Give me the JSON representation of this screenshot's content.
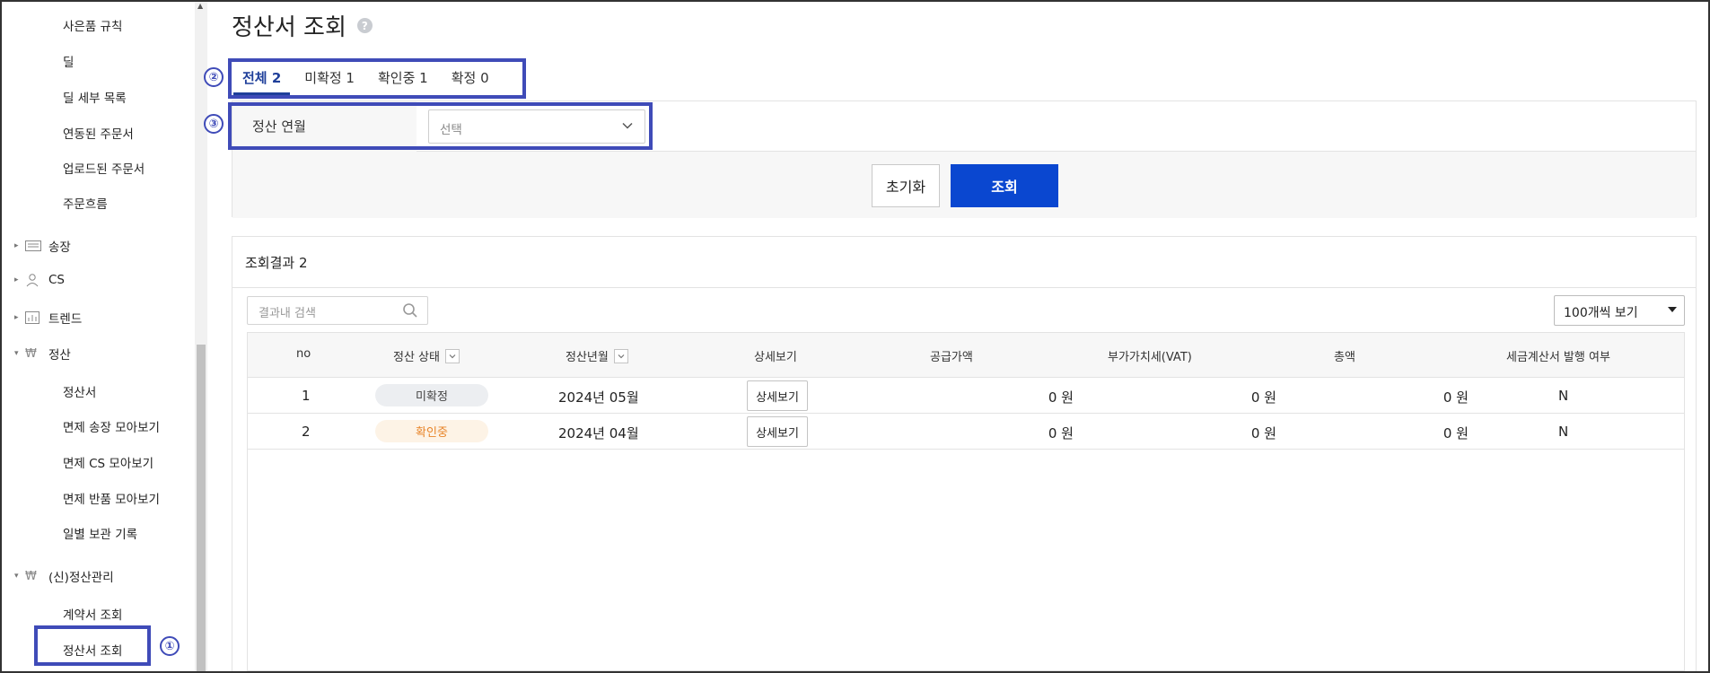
{
  "sidebar": {
    "top_items": [
      "사은품 규칙",
      "딜",
      "딜 세부 목록",
      "연동된 주문서",
      "업로드된 주문서",
      "주문흐름"
    ],
    "groups": {
      "songjang": "송장",
      "cs": "CS",
      "trend": "트렌드",
      "settlement": "정산",
      "new_settlement": "(신)정산관리"
    },
    "settlement_items": [
      "정산서",
      "면제 송장 모아보기",
      "면제 CS 모아보기",
      "면제 반품 모아보기",
      "일별 보관 기록"
    ],
    "new_settlement_items": [
      "계약서 조회",
      "정산서 조회"
    ]
  },
  "page": {
    "title": "정산서 조회",
    "help": "?"
  },
  "annotations": {
    "one": "①",
    "two": "②",
    "three": "③"
  },
  "tabs": [
    {
      "label": "전체 2",
      "active": true
    },
    {
      "label": "미확정 1",
      "active": false
    },
    {
      "label": "확인중 1",
      "active": false
    },
    {
      "label": "확정 0",
      "active": false
    }
  ],
  "filter": {
    "label": "정산 연월",
    "select_value": "선택",
    "reset_label": "초기화",
    "search_label": "조회"
  },
  "results": {
    "title": "조회결과 2",
    "search_placeholder": "결과내 검색",
    "per_page": "100개씩 보기",
    "columns": [
      "no",
      "정산 상태",
      "정산년월",
      "상세보기",
      "공급가액",
      "부가가치세(VAT)",
      "총액",
      "세금계산서 발행 여부"
    ],
    "rows": [
      {
        "no": "1",
        "status": "미확정",
        "month": "2024년 05월",
        "detail": "상세보기",
        "supply": "0 원",
        "vat": "0 원",
        "total": "0 원",
        "invoice": "N"
      },
      {
        "no": "2",
        "status": "확인중",
        "month": "2024년 04월",
        "detail": "상세보기",
        "supply": "0 원",
        "vat": "0 원",
        "total": "0 원",
        "invoice": "N"
      }
    ]
  },
  "colors": {
    "primary_button": "#0a47d0",
    "annotation": "#3f4bb8",
    "status_unconfirmed_bg": "#eceef1",
    "status_checking_bg": "#fdf3e6",
    "status_checking_text": "#e8852a"
  }
}
